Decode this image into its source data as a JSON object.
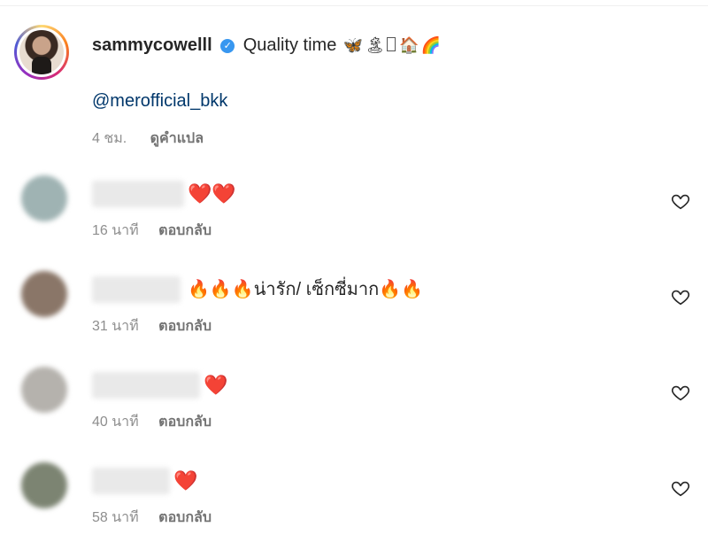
{
  "post": {
    "username": "sammycowelll",
    "verified_mark": "✓",
    "caption": "Quality time",
    "caption_emojis": [
      "🦋",
      "🏝",
      "",
      "🏠",
      "🌈"
    ],
    "mention": "@merofficial_bkk",
    "time": "4 ชม.",
    "translate_label": "ดูคำแปล"
  },
  "comments": [
    {
      "text": "❤️❤️",
      "time": "16 นาที",
      "reply_label": "ตอบกลับ",
      "avatar_color": "#9fb3b3"
    },
    {
      "text": "🔥🔥🔥น่ารัก/ เซ็กซี่มาก🔥🔥",
      "time": "31 นาที",
      "reply_label": "ตอบกลับ",
      "avatar_color": "#8a7668"
    },
    {
      "text": "❤️",
      "time": "40 นาที",
      "reply_label": "ตอบกลับ",
      "avatar_color": "#b5b2ad"
    },
    {
      "text": "❤️",
      "time": "58 นาที",
      "reply_label": "ตอบกลับ",
      "avatar_color": "#7c8472"
    }
  ],
  "icons": {
    "like": "heart-outline-icon",
    "verified": "verified-badge-icon"
  }
}
